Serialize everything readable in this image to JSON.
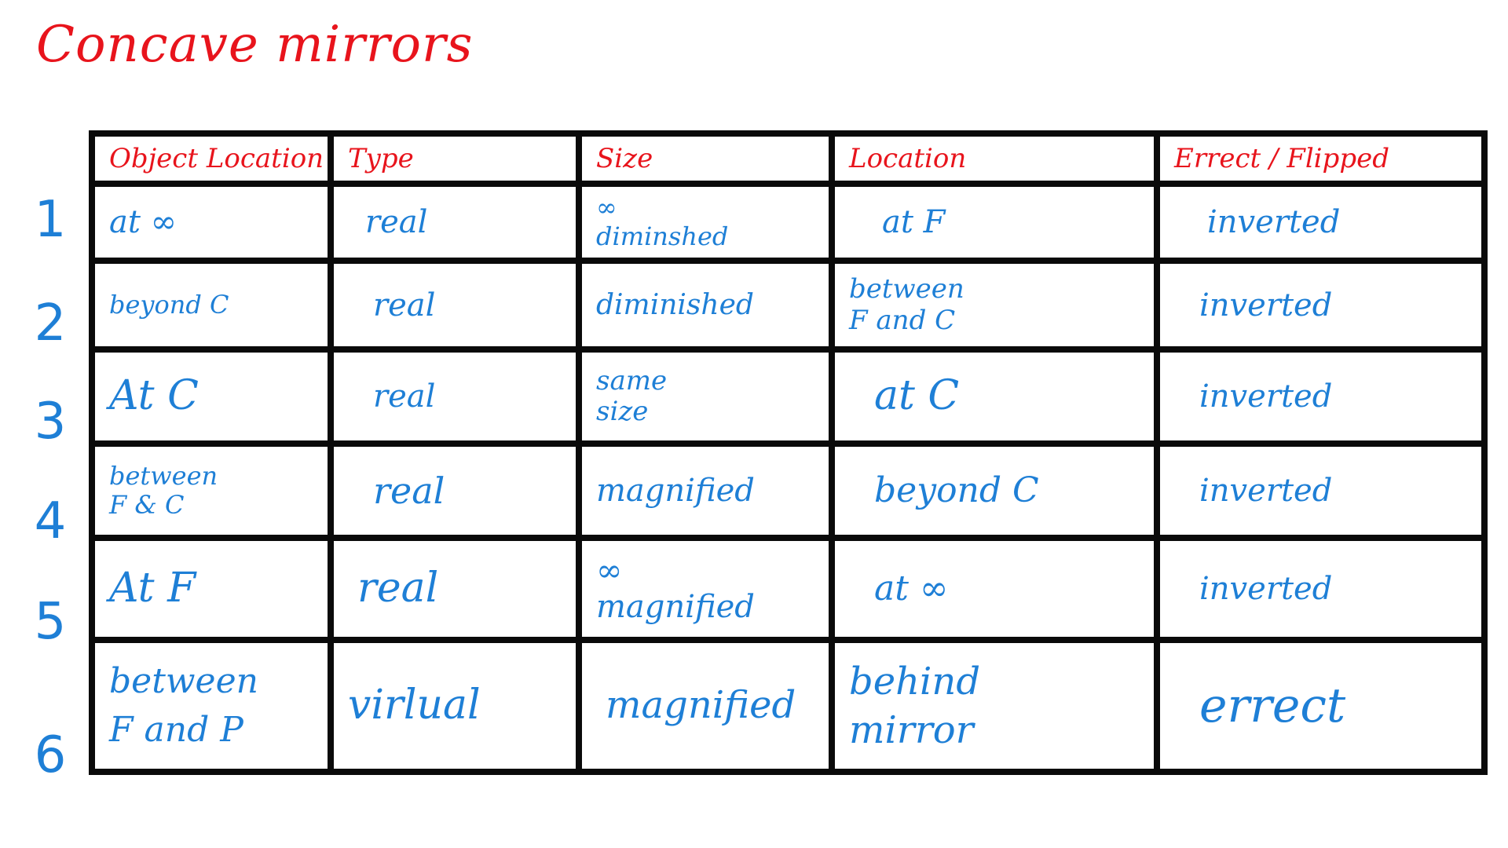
{
  "title": "Concave mirrors",
  "headers": [
    "Object Location",
    "Type",
    "Size",
    "Location",
    "Errect / Flipped"
  ],
  "rows": [
    {
      "number": "1",
      "cells": [
        "at ∞",
        "real",
        "∞\ndiminshed",
        "at F",
        "inverted"
      ]
    },
    {
      "number": "2",
      "cells": [
        "beyond C",
        "real",
        "diminished",
        "between\nF and C",
        "inverted"
      ]
    },
    {
      "number": "3",
      "cells": [
        "At C",
        "real",
        "same\nsize",
        "at C",
        "inverted"
      ]
    },
    {
      "number": "4",
      "cells": [
        "between\nF & C",
        "real",
        "magnified",
        "beyond C",
        "inverted"
      ]
    },
    {
      "number": "5",
      "cells": [
        "At F",
        "real",
        "∞\nmagnified",
        "at ∞",
        "inverted"
      ]
    },
    {
      "number": "6",
      "cells": [
        "between\nF and P",
        "virlual",
        "magnified",
        "behind\nmirror",
        "errect"
      ]
    }
  ],
  "colors": {
    "title": "#e8141c",
    "header_text": "#e8141c",
    "cell_text": "#1e7fd6",
    "grid_lines": "#0a0a0a"
  }
}
